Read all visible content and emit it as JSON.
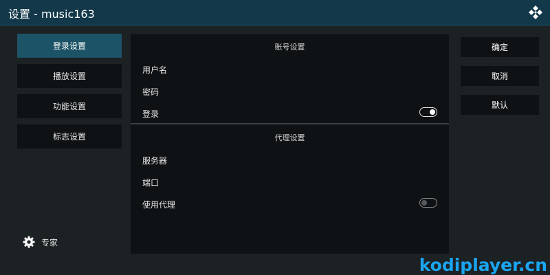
{
  "window": {
    "title": "设置 - music163",
    "logo_icon": "kodi-logo-icon"
  },
  "categories": [
    {
      "label": "登录设置",
      "active": true
    },
    {
      "label": "播放设置",
      "active": false
    },
    {
      "label": "功能设置",
      "active": false
    },
    {
      "label": "标志设置",
      "active": false
    }
  ],
  "expert": {
    "label": "专家",
    "icon": "gear-icon"
  },
  "settings": {
    "account_section": {
      "header": "账号设置",
      "rows": [
        {
          "label": "用户名"
        },
        {
          "label": "密码"
        },
        {
          "label": "登录",
          "toggle": "on"
        }
      ]
    },
    "proxy_section": {
      "header": "代理设置",
      "rows": [
        {
          "label": "服务器"
        },
        {
          "label": "端口"
        },
        {
          "label": "使用代理",
          "toggle": "off"
        }
      ]
    }
  },
  "actions": {
    "ok": "确定",
    "cancel": "取消",
    "default": "默认"
  },
  "watermark": "kodiplayer.cn",
  "colors": {
    "titlebar": "#12384a",
    "active_category": "#1c5366",
    "watermark": "#1aa5f0"
  }
}
